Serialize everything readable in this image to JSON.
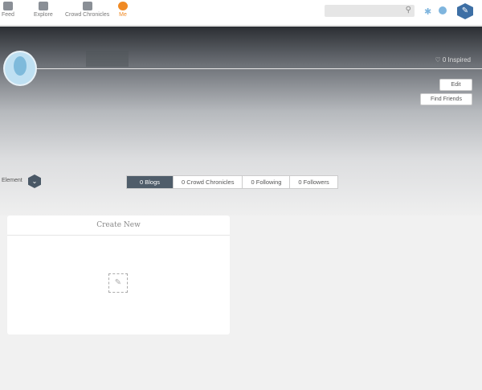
{
  "nav": [
    {
      "label": "Feed",
      "icon": "butterfly-icon"
    },
    {
      "label": "Explore",
      "icon": "binoculars-icon"
    },
    {
      "label": "Crowd Chronicles",
      "icon": "people-icon"
    },
    {
      "label": "Me",
      "icon": "person-icon"
    }
  ],
  "search": {
    "placeholder": ""
  },
  "profile": {
    "inspired": "0 Inspired",
    "edit": "Edit",
    "find_friends": "Find Friends",
    "element": "Element"
  },
  "tabs": [
    "0 Blogs",
    "0 Crowd Chronicles",
    "0 Following",
    "0 Followers"
  ],
  "card": {
    "title": "Create New"
  },
  "colors": {
    "accent": "#f08a24",
    "tab_active": "#4f5d6a",
    "brand": "#3d6fa5"
  }
}
